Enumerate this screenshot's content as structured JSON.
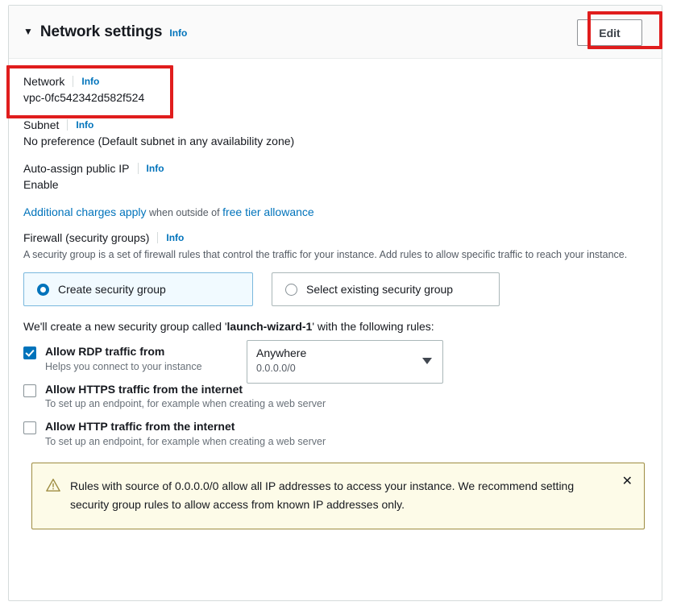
{
  "panel": {
    "caret_glyph": "▼",
    "title": "Network settings",
    "info_label": "Info",
    "edit_label": "Edit"
  },
  "network": {
    "label": "Network",
    "info_label": "Info",
    "value": "vpc-0fc542342d582f524"
  },
  "subnet": {
    "label": "Subnet",
    "info_label": "Info",
    "value": "No preference (Default subnet in any availability zone)"
  },
  "auto_assign_ip": {
    "label": "Auto-assign public IP",
    "info_label": "Info",
    "value": "Enable"
  },
  "charges": {
    "link_text": "Additional charges apply",
    "middle_text": " when outside of ",
    "link_text_2": "free tier allowance"
  },
  "firewall": {
    "label": "Firewall (security groups)",
    "info_label": "Info",
    "description": "A security group is a set of firewall rules that control the traffic for your instance. Add rules to allow specific traffic to reach your instance.",
    "options": [
      {
        "label": "Create security group",
        "selected": true
      },
      {
        "label": "Select existing security group",
        "selected": false
      }
    ],
    "sg_note_prefix": "We'll create a new security group called '",
    "sg_name": "launch-wizard-1",
    "sg_note_suffix": "' with the following rules:"
  },
  "rules": [
    {
      "title": "Allow RDP traffic from",
      "subtitle": "Helps you connect to your instance",
      "checked": true,
      "source": {
        "value": "Anywhere",
        "cidr": "0.0.0.0/0"
      }
    },
    {
      "title": "Allow HTTPS traffic from the internet",
      "subtitle": "To set up an endpoint, for example when creating a web server",
      "checked": false
    },
    {
      "title": "Allow HTTP traffic from the internet",
      "subtitle": "To set up an endpoint, for example when creating a web server",
      "checked": false
    }
  ],
  "alert": {
    "icon": "warning-triangle-icon",
    "text": "Rules with source of 0.0.0.0/0 allow all IP addresses to access your instance. We recommend setting security group rules to allow access from known IP addresses only.",
    "close_glyph": "✕"
  },
  "annotations": {
    "highlight_color": "#e01d1d",
    "targets": [
      "edit-button",
      "network-field"
    ]
  },
  "colors": {
    "link": "#0073bb",
    "selected_tile_bg": "#f1faff",
    "alert_bg": "#fdfbe8",
    "alert_border": "#9e8c41",
    "header_bg": "#fafafa"
  }
}
